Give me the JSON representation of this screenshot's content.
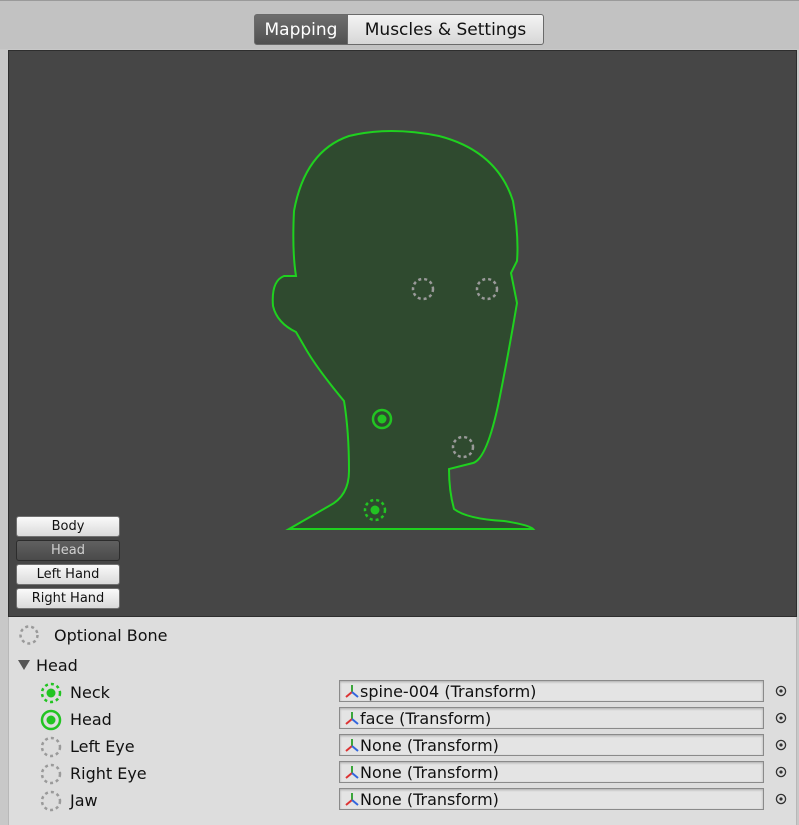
{
  "tabs": [
    {
      "label": "Mapping",
      "active": true
    },
    {
      "label": "Muscles & Settings",
      "active": false
    }
  ],
  "body_view_buttons": [
    {
      "label": "Body",
      "active": false
    },
    {
      "label": "Head",
      "active": true
    },
    {
      "label": "Left Hand",
      "active": false
    },
    {
      "label": "Right Hand",
      "active": false
    }
  ],
  "legend": {
    "label": "Optional Bone"
  },
  "section": {
    "label": "Head",
    "expanded": true
  },
  "bones": [
    {
      "name": "Neck",
      "value": "spine-004 (Transform)",
      "status": "optional-mapped"
    },
    {
      "name": "Head",
      "value": "face (Transform)",
      "status": "required-mapped"
    },
    {
      "name": "Left Eye",
      "value": "None (Transform)",
      "status": "optional-empty"
    },
    {
      "name": "Right Eye",
      "value": "None (Transform)",
      "status": "optional-empty"
    },
    {
      "name": "Jaw",
      "value": "None (Transform)",
      "status": "optional-empty"
    }
  ],
  "colors": {
    "mapped": "#22c422",
    "silhouette_outline": "#1fd11f",
    "silhouette_fill": "#2f4a2f",
    "empty_slot": "#9a9a9a",
    "viewport_bg": "#464646"
  }
}
